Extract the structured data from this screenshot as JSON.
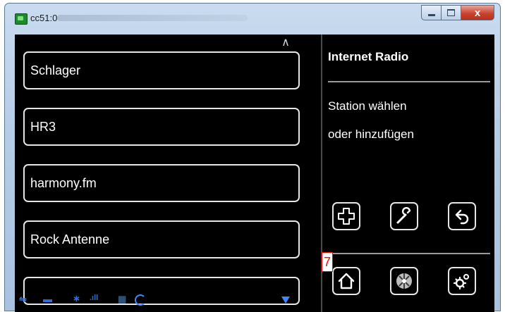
{
  "window": {
    "title": "cc51:0",
    "close_glyph": "x",
    "app_icon": "terminal-icon"
  },
  "colors": {
    "screen_bg": "#000000",
    "text": "#ffffff",
    "button_border": "#e6e6e6",
    "status_icons": "#3f88ff",
    "marker": "#ff0000"
  },
  "stations": [
    {
      "label": "Schlager"
    },
    {
      "label": "HR3"
    },
    {
      "label": "harmony.fm"
    },
    {
      "label": "Rock Antenne"
    },
    {
      "label": ""
    }
  ],
  "panel": {
    "title": "Internet Radio",
    "line1": "Station wählen",
    "line2": "oder hinzufügen"
  },
  "actions": [
    {
      "name": "add-icon"
    },
    {
      "name": "wrench-icon"
    },
    {
      "name": "back-icon"
    }
  ],
  "nav": [
    {
      "name": "home-icon"
    },
    {
      "name": "fan-icon"
    },
    {
      "name": "settings-icon"
    }
  ],
  "status_icons": [
    "signal-icon",
    "car-icon",
    "bluetooth-icon",
    "bars-icon",
    "grid-icon",
    "sync-icon",
    "download-icon"
  ],
  "marker": {
    "label": "7"
  }
}
